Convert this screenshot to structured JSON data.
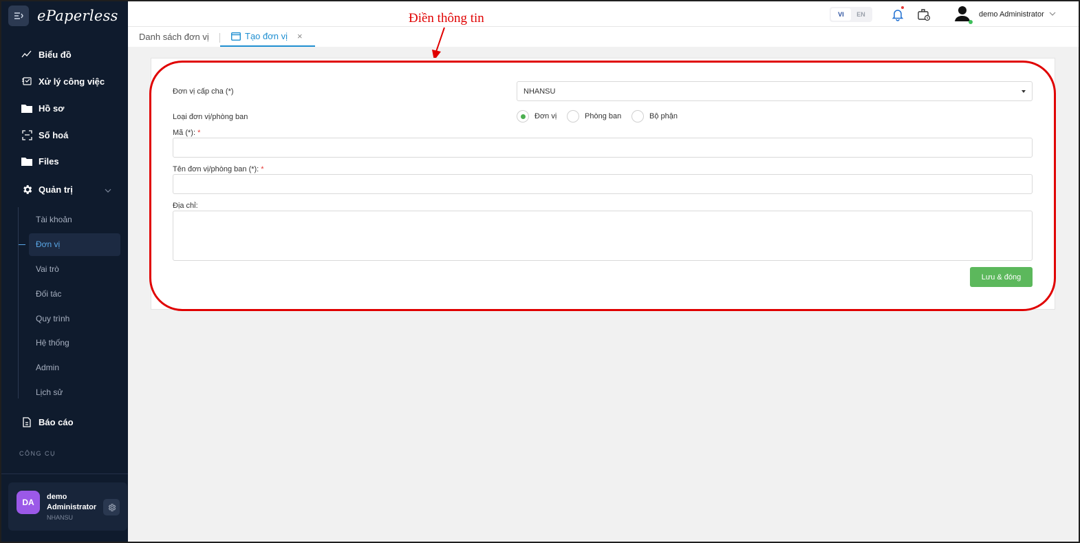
{
  "app": {
    "name": "ePaperless"
  },
  "sidebar": {
    "items": [
      {
        "label": "Biểu đồ",
        "icon": "chart-line-icon"
      },
      {
        "label": "Xử lý công việc",
        "icon": "task-icon"
      },
      {
        "label": "Hồ sơ",
        "icon": "folder-icon"
      },
      {
        "label": "Số hoá",
        "icon": "scan-icon"
      },
      {
        "label": "Files",
        "icon": "folder-icon"
      },
      {
        "label": "Quản trị",
        "icon": "gear-icon"
      },
      {
        "label": "Báo cáo",
        "icon": "report-icon"
      }
    ],
    "admin_sub": [
      "Tài khoản",
      "Đơn vị",
      "Vai trò",
      "Đối tác",
      "Quy trình",
      "Hệ thống",
      "Admin",
      "Lịch sử"
    ],
    "active_sub": "Đơn vị",
    "section_label": "CÔNG CỤ",
    "profile": {
      "initials": "DA",
      "name": "demo Administrator",
      "org": "NHANSU"
    }
  },
  "topbar": {
    "lang_vi": "VI",
    "lang_en": "EN",
    "user_name": "demo Administrator"
  },
  "tabs": [
    {
      "label": "Danh sách đơn vị"
    },
    {
      "label": "Tạo đơn vị",
      "close": "×"
    }
  ],
  "annotation": {
    "text": "Điền thông tin"
  },
  "form": {
    "parent_label": "Đơn vị cấp cha (*)",
    "parent_value": "NHANSU",
    "type_label": "Loại đơn vị/phòng ban",
    "type_options": [
      "Đơn vị",
      "Phòng ban",
      "Bộ phận"
    ],
    "type_selected": "Đơn vị",
    "code_label": "Mã (*):",
    "name_label": "Tên đơn vị/phòng ban (*):",
    "address_label": "Địa chỉ:",
    "required_mark": "*",
    "save_label": "Lưu & đóng"
  },
  "colors": {
    "sidebar_bg": "#0f1b2d",
    "accent": "#1f8fd1",
    "save": "#5cb85c",
    "annotation": "#e00000"
  }
}
